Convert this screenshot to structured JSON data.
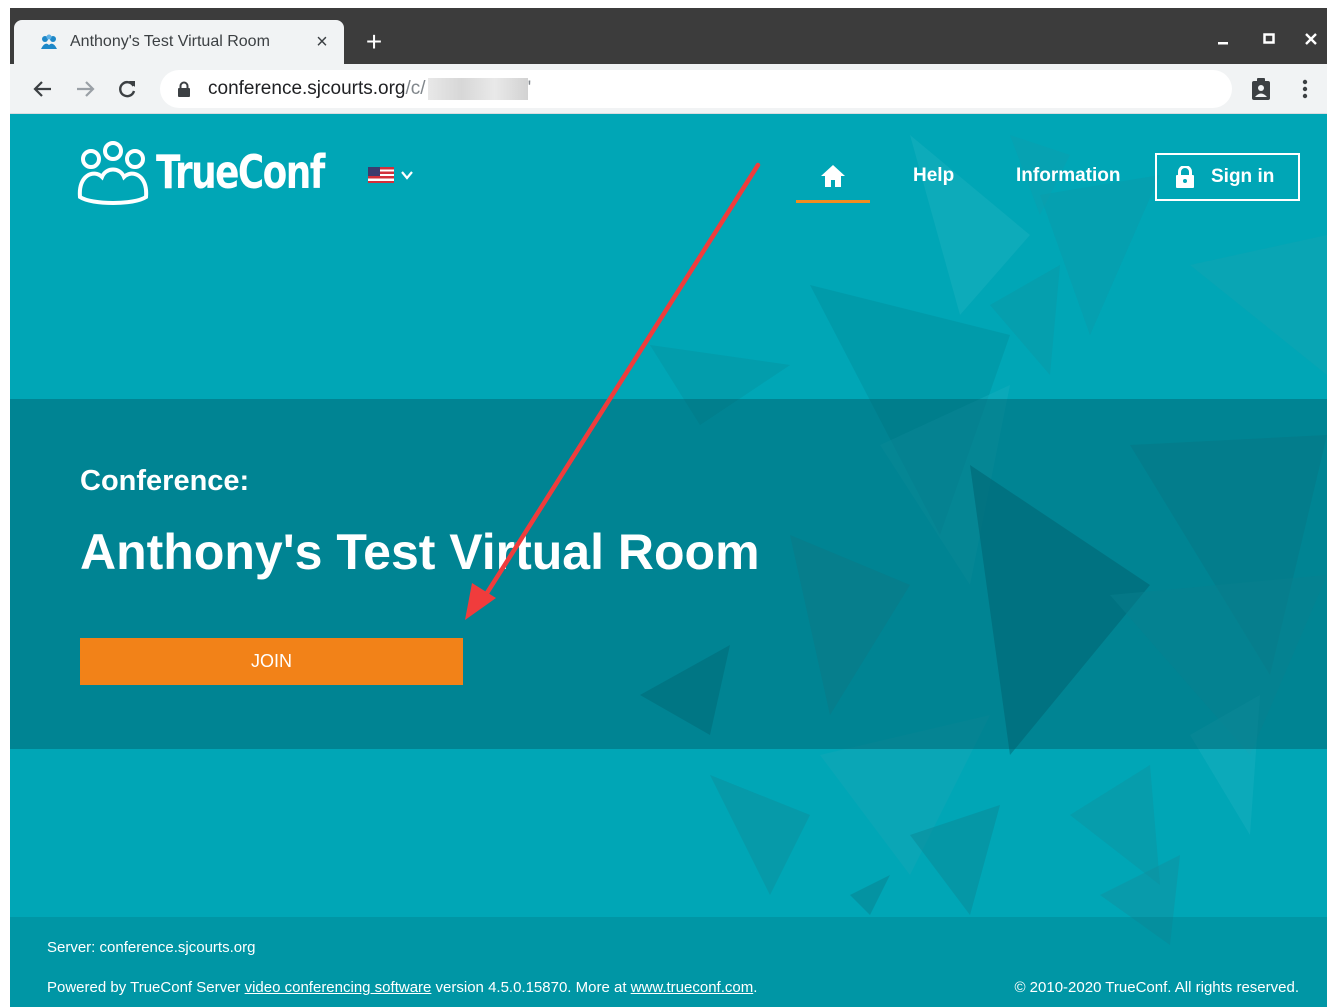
{
  "browser": {
    "tab_title": "Anthony's Test Virtual Room",
    "new_tab": "+",
    "url_host": "conference.sjcourts.org",
    "url_path": "/c/",
    "url_tail": "'"
  },
  "header": {
    "logo_text": "TrueConf",
    "nav": {
      "help": "Help",
      "information": "Information",
      "sign_in": "Sign in"
    }
  },
  "main": {
    "conference_label": "Conference:",
    "conference_title": "Anthony's Test Virtual Room",
    "join_label": "JOIN"
  },
  "footer": {
    "server": "Server: conference.sjcourts.org",
    "powered_prefix": "Powered by TrueConf Server ",
    "powered_link": "video conferencing software",
    "powered_middle": " version 4.5.0.15870. More at ",
    "site_link": "www.trueconf.com",
    "powered_suffix": ".",
    "copyright": "© 2010-2020 TrueConf. All rights reserved."
  },
  "colors": {
    "page_bg": "#00a6b6",
    "accent_orange": "#f28218",
    "chrome_dark": "#3c3c3c",
    "annotation_arrow": "#f03c3c"
  }
}
